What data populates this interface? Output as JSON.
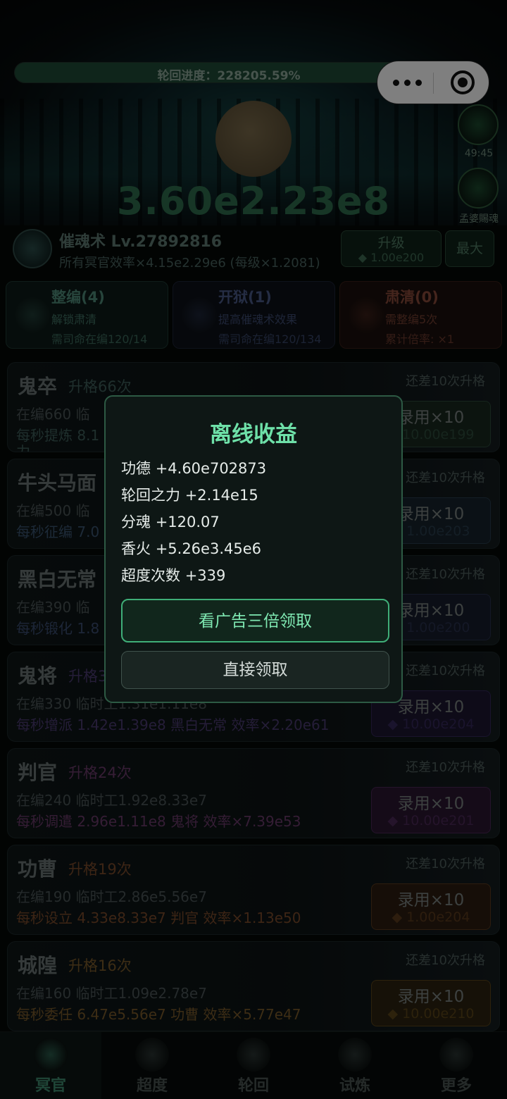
{
  "header": {
    "progress_text": "轮回进度：228205.59%",
    "currency": "3.60e2.23e8"
  },
  "side": {
    "timer": "49:45",
    "buff_label": "孟婆賜魂"
  },
  "skill": {
    "title": "催魂术 Lv.27892816",
    "desc": "所有冥官效率×4.15e2.29e6 (每级×1.2081)",
    "upgrade_label": "升级",
    "upgrade_cost": "◆ 1.00e200",
    "max_label": "最大"
  },
  "reforms": [
    {
      "title": "整编(4)",
      "line1": "解锁肃清",
      "line2": "需司命在编120/14",
      "color": "#4f8a78",
      "bg": "#0d1a18",
      "border": "#1f3a34"
    },
    {
      "title": "开狱(1)",
      "line1": "提高催魂术效果",
      "line2": "需司命在编120/134",
      "color": "#4a5a88",
      "bg": "#0d1118",
      "border": "#1c2436"
    },
    {
      "title": "肃清(0)",
      "line1": "需整编5次",
      "line2": "累计倍率: ×1",
      "color": "#8a4a3a",
      "bg": "#1a0f0c",
      "border": "#3a1f18"
    }
  ],
  "units": [
    {
      "name": "鬼卒",
      "grade": "升格66次",
      "gap": "还差10次升格",
      "count": "在编660  临",
      "rate": "每秒提炼 8.1",
      "rate_extra": "力",
      "btn_label": "录用×10",
      "btn_cost": "◆ 10.00e199",
      "accent": "#3e5e5a",
      "btn_bg": "#18281f",
      "btn_border": "#2d4a3a"
    },
    {
      "name": "牛头马面",
      "grade": "",
      "gap": "还差10次升格",
      "count": "在编500  临",
      "rate": "每秒征编 7.0",
      "btn_label": "录用×10",
      "btn_cost": "◆ 1.00e203",
      "accent": "#3a5570",
      "btn_bg": "#16222c",
      "btn_border": "#283c4c"
    },
    {
      "name": "黑白无常",
      "grade": "",
      "gap": "还差10次升格",
      "count": "在编390  临",
      "rate": "每秒锻化 1.8",
      "btn_label": "录用×10",
      "btn_cost": "◆ 1.00e200",
      "accent": "#3a4d70",
      "btn_bg": "#161c2c",
      "btn_border": "#28304c"
    },
    {
      "name": "鬼将",
      "grade": "升格3",
      "gap": "还差10次升格",
      "count": "在编330  临时工1.31e1.11e8",
      "rate": "每秒增派 1.42e1.39e8 黑白无常  效率×2.20e61",
      "btn_label": "录用×10",
      "btn_cost": "◆ 10.00e204",
      "accent": "#4a3a70",
      "btn_bg": "#1c1630",
      "btn_border": "#34285a"
    },
    {
      "name": "判官",
      "grade": "升格24次",
      "gap": "还差10次升格",
      "count": "在编240  临时工1.92e8.33e7",
      "rate": "每秒调遣 2.96e1.11e8 鬼将  效率×7.39e53",
      "btn_label": "录用×10",
      "btn_cost": "◆ 10.00e201",
      "accent": "#6a3a6a",
      "btn_bg": "#2a1630",
      "btn_border": "#4a2856"
    },
    {
      "name": "功曹",
      "grade": "升格19次",
      "gap": "还差10次升格",
      "count": "在编190  临时工2.86e5.56e7",
      "rate": "每秒设立 4.33e8.33e7 判官  效率×1.13e50",
      "btn_label": "录用×10",
      "btn_cost": "◆ 1.00e204",
      "accent": "#7a4a2a",
      "btn_bg": "#2c1c10",
      "btn_border": "#5a3a1c"
    },
    {
      "name": "城隍",
      "grade": "升格16次",
      "gap": "还差10次升格",
      "count": "在编160  临时工1.09e2.78e7",
      "rate": "每秒委任 6.47e5.56e7 功曹  效率×5.77e47",
      "btn_label": "录用×10",
      "btn_cost": "◆ 10.00e210",
      "accent": "#7a5a2a",
      "btn_bg": "#2c2210",
      "btn_border": "#5a4418"
    }
  ],
  "tabs": [
    {
      "label": "冥官",
      "active": true
    },
    {
      "label": "超度",
      "active": false
    },
    {
      "label": "轮回",
      "active": false
    },
    {
      "label": "试炼",
      "active": false
    },
    {
      "label": "更多",
      "active": false
    }
  ],
  "dialog": {
    "title": "离线收益",
    "rows": [
      {
        "label": "功德",
        "value": "+4.60e702873"
      },
      {
        "label": "轮回之力",
        "value": "+2.14e15"
      },
      {
        "label": "分魂",
        "value": "+120.07"
      },
      {
        "label": "香火",
        "value": "+5.26e3.45e6"
      },
      {
        "label": "超度次数",
        "value": "+339"
      }
    ],
    "ad_button": "看广告三倍领取",
    "direct_button": "直接领取"
  },
  "colors": {
    "accent_green": "#6ee0a8",
    "dialog_border": "#2d5a44",
    "tab_active": "#3f8a6e",
    "tab_inactive": "#4a5552"
  },
  "icons": [
    "more-dots-icon",
    "close-target-icon",
    "timer-buff-icon",
    "soul-buff-icon",
    "skill-icon",
    "tab-icon"
  ]
}
